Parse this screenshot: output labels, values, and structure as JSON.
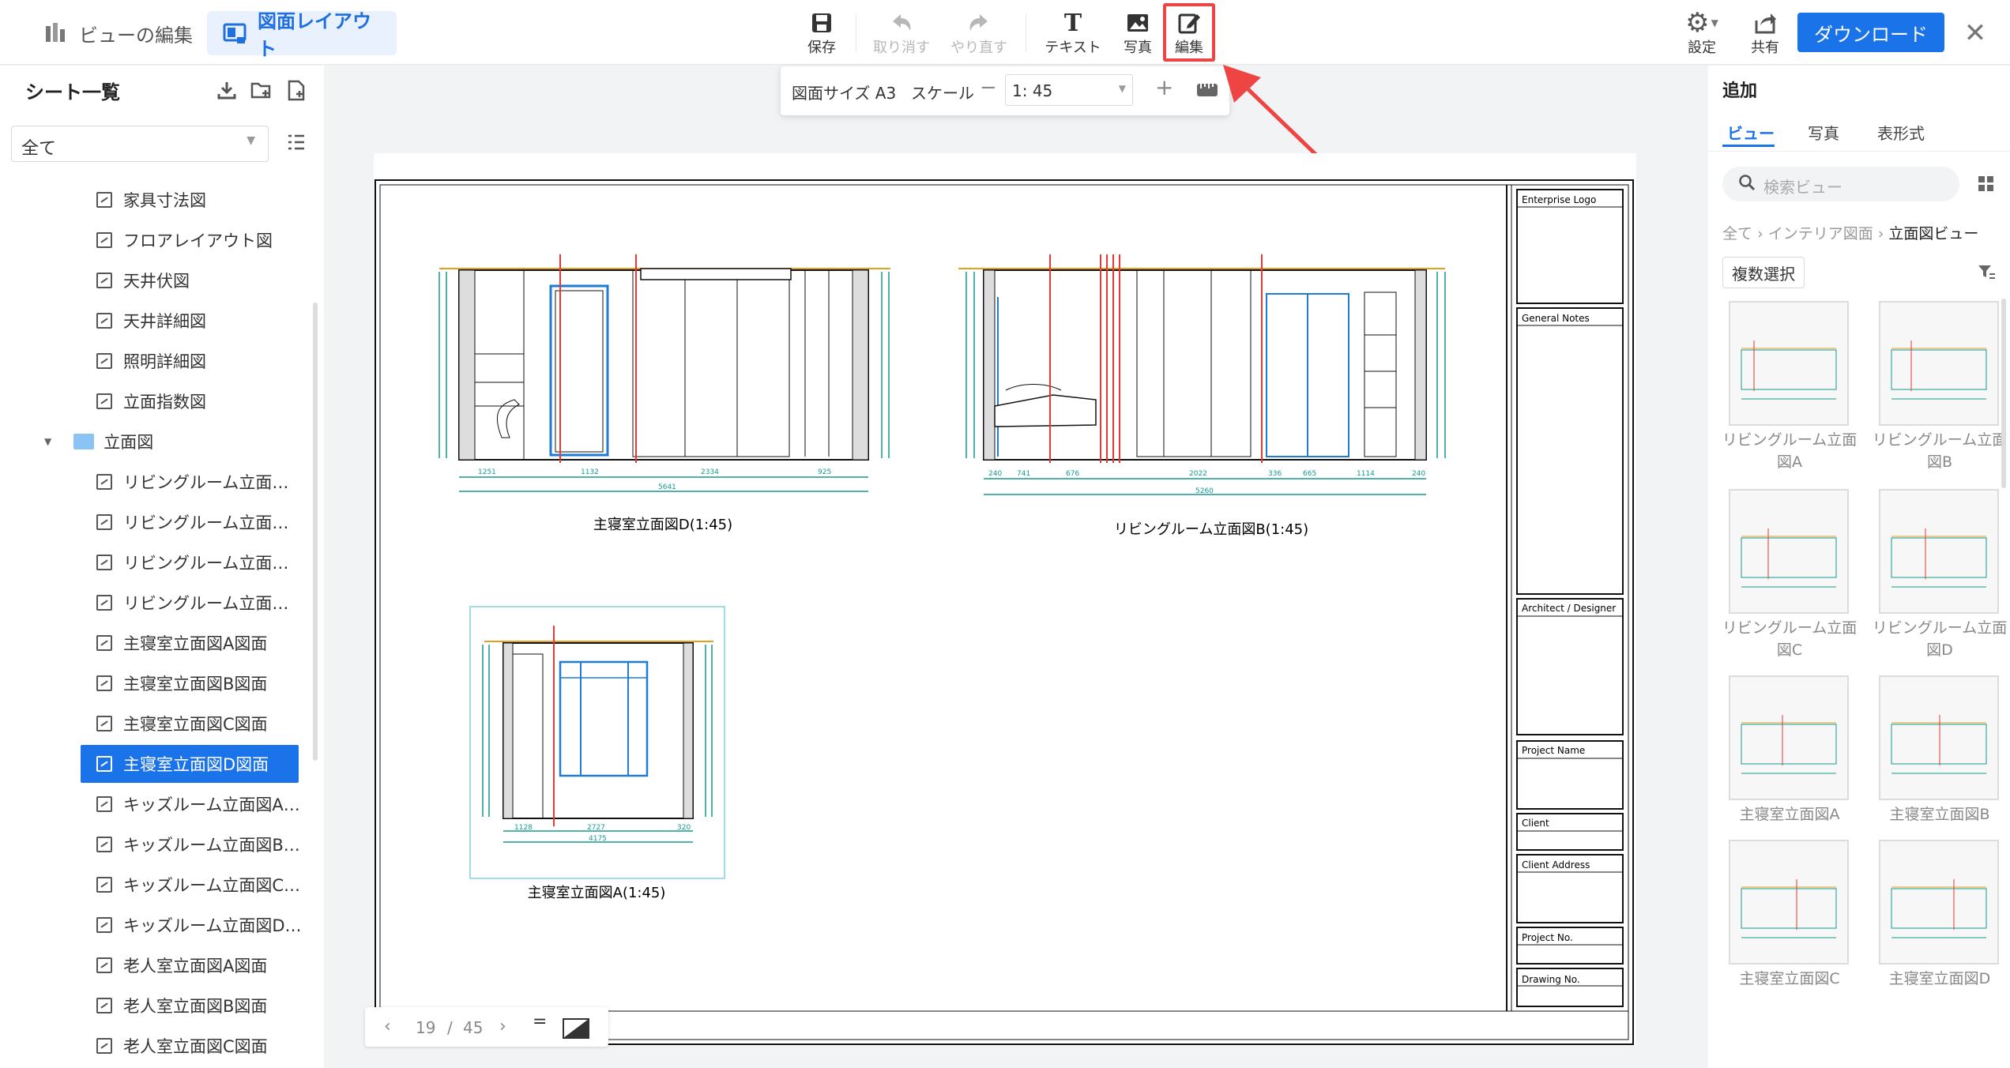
{
  "toolbar": {
    "mode_edit_view": "ビューの編集",
    "mode_layout": "図面レイアウト",
    "save": "保存",
    "undo": "取り消す",
    "redo": "やり直す",
    "text": "テキスト",
    "photo": "写真",
    "edit": "編集",
    "settings": "設定",
    "share": "共有",
    "download": "ダウンロード"
  },
  "scale_bar": {
    "paper_size_label": "図面サイズ A3",
    "scale_label": "スケール",
    "scale_value": "1: 45"
  },
  "sheet_list": {
    "title": "シート一覧",
    "filter_value": "全て",
    "items": [
      "家具寸法図",
      "フロアレイアウト図",
      "天井伏図",
      "天井詳細図",
      "照明詳細図",
      "立面指数図"
    ],
    "folder": "立面図",
    "folder_items": [
      "リビングルーム立面…",
      "リビングルーム立面…",
      "リビングルーム立面…",
      "リビングルーム立面…",
      "主寝室立面図A図面",
      "主寝室立面図B図面",
      "主寝室立面図C図面",
      "主寝室立面図D図面",
      "キッズルーム立面図A…",
      "キッズルーム立面図B…",
      "キッズルーム立面図C…",
      "キッズルーム立面図D…",
      "老人室立面図A図面",
      "老人室立面図B図面",
      "老人室立面図C図面"
    ]
  },
  "sheet": {
    "titleblock": [
      "Enterprise Logo",
      "General Notes",
      "Architect / Designer",
      "Project Name",
      "Client",
      "Client Address",
      "Project No.",
      "Drawing No."
    ],
    "drawing_titles": [
      "主寝室立面図D(1:45)",
      "リビングルーム立面図B(1:45)",
      "主寝室立面図A(1:45)"
    ],
    "dims_d": [
      "1251",
      "1132",
      "2334",
      "925",
      "5641"
    ],
    "dims_b": [
      "240",
      "741",
      "676",
      "2022",
      "336",
      "665",
      "1114",
      "240",
      "5260"
    ],
    "dims_a": [
      "1128",
      "2727",
      "320",
      "4175"
    ]
  },
  "pager": {
    "current": "19",
    "sep": "/",
    "total": "45"
  },
  "add_panel": {
    "title": "追加",
    "tabs": [
      "ビュー",
      "写真",
      "表形式"
    ],
    "search_placeholder": "検索ビュー",
    "breadcrumb": [
      "全て",
      "インテリア図面",
      "立面図ビュー"
    ],
    "multi_select": "複数選択",
    "thumbs": [
      "リビングルーム立面図A",
      "リビングルーム立面図B",
      "リビングルーム立面図C",
      "リビングルーム立面図D",
      "主寝室立面図A",
      "主寝室立面図B",
      "主寝室立面図C",
      "主寝室立面図D"
    ]
  },
  "icons": [
    "view-edit-icon",
    "layout-icon",
    "save-icon",
    "undo-icon",
    "redo-icon",
    "text-icon",
    "photo-icon",
    "edit-icon",
    "gear-icon",
    "share-icon",
    "close-icon",
    "download-icon",
    "new-folder-icon",
    "new-file-icon",
    "list-icon",
    "folder-icon",
    "search-icon",
    "grid-icon",
    "filter-icon",
    "chevron-left-icon",
    "chevron-right-icon"
  ],
  "colors": {
    "accent": "#1a73e8",
    "highlight": "#ef4444",
    "drawing_red": "#e53935",
    "drawing_teal": "#159a8f",
    "drawing_orange": "#e0a020",
    "drawing_blue": "#1e7bd6"
  }
}
